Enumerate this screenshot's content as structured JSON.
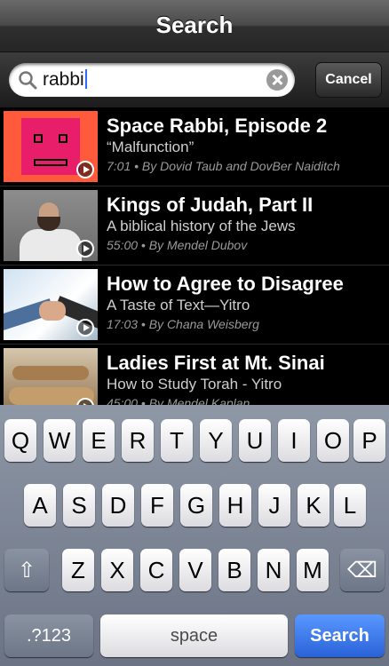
{
  "nav": {
    "title": "Search"
  },
  "search": {
    "query": "rabbi",
    "cancel_label": "Cancel"
  },
  "results": [
    {
      "title": "Space Rabbi, Episode 2",
      "subtitle": "“Malfunction”",
      "meta": "7:01 • By Dovid Taub and DovBer Naiditch"
    },
    {
      "title": "Kings of Judah, Part II",
      "subtitle": "A biblical history of the Jews",
      "meta": "55:00 • By Mendel Dubov"
    },
    {
      "title": "How to Agree to Disagree",
      "subtitle": "A Taste of Text—Yitro",
      "meta": "17:03 • By Chana Weisberg"
    },
    {
      "title": "Ladies First at Mt. Sinai",
      "subtitle": "How to Study Torah - Yitro",
      "meta": "45:00 • By Mendel Kaplan"
    }
  ],
  "keyboard": {
    "row1": [
      "Q",
      "W",
      "E",
      "R",
      "T",
      "Y",
      "U",
      "I",
      "O",
      "P"
    ],
    "row2": [
      "A",
      "S",
      "D",
      "F",
      "G",
      "H",
      "J",
      "K",
      "L"
    ],
    "row3": [
      "Z",
      "X",
      "C",
      "V",
      "B",
      "N",
      "M"
    ],
    "shift_glyph": "⇧",
    "delete_glyph": "⌫",
    "numbers_label": ".?123",
    "space_label": "space",
    "search_label": "Search"
  },
  "colors": {
    "accent": "#2a62d8",
    "nav_bg": "#3a3a3a",
    "caret": "#2b6bff"
  },
  "icons": [
    "search-icon",
    "clear-icon",
    "play-icon",
    "shift-icon",
    "delete-icon"
  ]
}
